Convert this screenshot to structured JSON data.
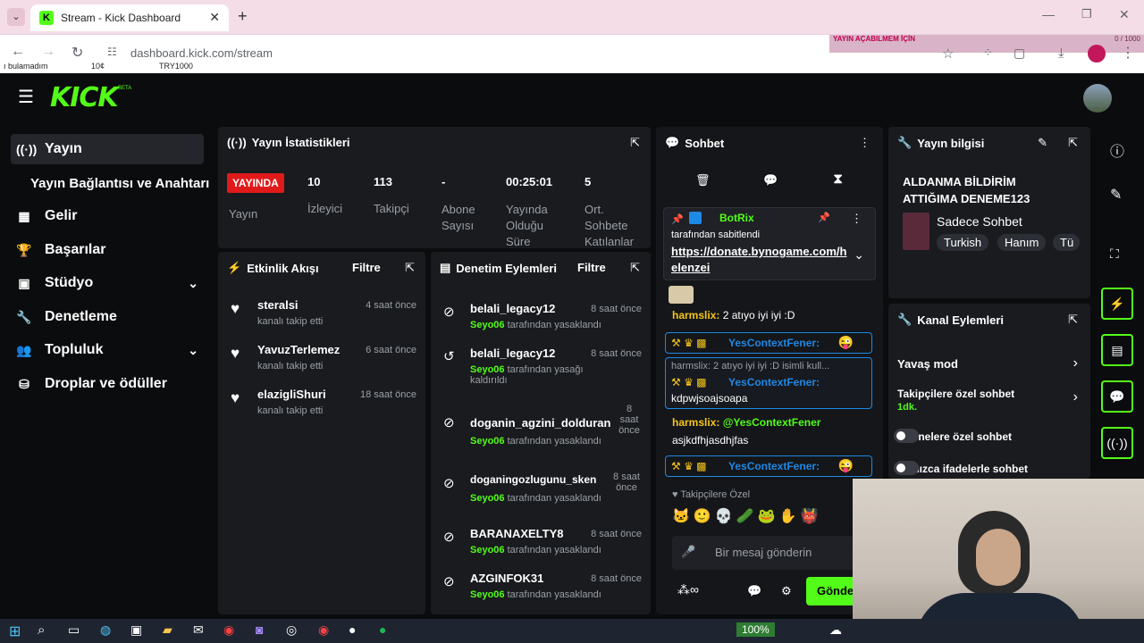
{
  "browser": {
    "tab_title": "Stream - Kick Dashboard",
    "url": "dashboard.kick.com/stream",
    "bookmarks": [
      "ı bulamadım",
      "10¢",
      "TRY1000"
    ],
    "overlay_title": "YAYIN AÇABILMEM İÇİN",
    "overlay_count": "0 / 1000"
  },
  "header": {
    "logo": "KICK",
    "beta": "BETA"
  },
  "sidebar": {
    "items": [
      {
        "label": "Yayın",
        "icon": "broadcast-icon"
      },
      {
        "label": "Yayın Bağlantısı ve Anahtarı",
        "icon": ""
      },
      {
        "label": "Gelir",
        "icon": "chart-icon"
      },
      {
        "label": "Başarılar",
        "icon": "trophy-icon"
      },
      {
        "label": "Stüdyo",
        "icon": "studio-icon"
      },
      {
        "label": "Denetleme",
        "icon": "wrench-icon"
      },
      {
        "label": "Topluluk",
        "icon": "community-icon"
      },
      {
        "label": "Droplar ve ödüller",
        "icon": "drops-icon"
      }
    ]
  },
  "stats": {
    "title": "Yayın İstatistikleri",
    "live_badge": "YAYINDA",
    "items": [
      {
        "value": "10",
        "label": "İzleyici"
      },
      {
        "value": "113",
        "label": "Takipçi"
      },
      {
        "value": "-",
        "label": "Abone Sayısı"
      },
      {
        "value": "00:25:01",
        "label": "Yayında Olduğu Süre"
      },
      {
        "value": "5",
        "label": "Ort. Sohbete Katılanlar"
      }
    ],
    "first_label": "Yayın"
  },
  "activity": {
    "title": "Etkinlik Akışı",
    "filter": "Filtre",
    "items": [
      {
        "name": "steralsi",
        "sub": "kanalı takip etti",
        "time": "4 saat önce"
      },
      {
        "name": "YavuzTerlemez",
        "sub": "kanalı takip etti",
        "time": "6 saat önce"
      },
      {
        "name": "elazigliShuri",
        "sub": "kanalı takip etti",
        "time": "18 saat önce"
      }
    ]
  },
  "moderation": {
    "title": "Denetim Eylemleri",
    "filter": "Filtre",
    "items": [
      {
        "name": "belali_legacy12",
        "mod": "Seyo06",
        "action": "tarafından yasaklandı",
        "time": "8 saat önce"
      },
      {
        "name": "belali_legacy12",
        "mod": "Seyo06",
        "action": "tarafından yasağı kaldırıldı",
        "time": "8 saat önce"
      },
      {
        "name": "doganin_agzini_dolduran",
        "mod": "Seyo06",
        "action": "tarafından yasaklandı",
        "time": "8 saat önce"
      },
      {
        "name": "doganingozlugunu_sken",
        "mod": "Seyo06",
        "action": "tarafından yasaklandı",
        "time": "8 saat önce"
      },
      {
        "name": "BARANAXELTY8",
        "mod": "Seyo06",
        "action": "tarafından yasaklandı",
        "time": "8 saat önce"
      },
      {
        "name": "AZGINFOK31",
        "mod": "Seyo06",
        "action": "tarafından yasaklandı",
        "time": "8 saat önce"
      }
    ]
  },
  "chat": {
    "title": "Sohbet",
    "pinned_user": "BotRix",
    "pinned_by": "tarafından sabitlendi",
    "pinned_link": "https://donate.bynogame.com/helenzei",
    "messages": [
      {
        "user": "harmslix:",
        "text": "2 atıyo iyi iyi :D"
      },
      {
        "user": "YesContextFener:",
        "text": ""
      },
      {
        "user": "harmslix: 2 atıyo iyi iyi :D isimli kull...",
        "text": ""
      },
      {
        "user": "YesContextFener:",
        "text": "kdpwjsoajsoapa"
      },
      {
        "user": "harmslix:",
        "text": "@YesContextFener"
      },
      {
        "user": "",
        "text": "asjkdfhjasdhjfas"
      },
      {
        "user": "YesContextFener:",
        "text": ""
      }
    ],
    "followers_only": "Takipçilere Özel",
    "placeholder": "Bir mesaj gönderin",
    "send": "Gönder"
  },
  "stream_info": {
    "title": "Yayın bilgisi",
    "stream_title": "ALDANMA BİLDİRİM ATTIĞIMA DENEME123",
    "category": "Sadece Sohbet",
    "tags": [
      "Turkish",
      "Hanım",
      "Tü"
    ]
  },
  "channel_actions": {
    "title": "Kanal Eylemleri",
    "items": [
      {
        "label": "Yavaş mod",
        "sub": ""
      },
      {
        "label": "Takipçilere özel sohbet",
        "sub": "1dk."
      },
      {
        "label": "Abonelere özel sohbet",
        "sub": ""
      },
      {
        "label": "Yalnızca ifadelerle sohbet",
        "sub": ""
      }
    ]
  },
  "taskbar": {
    "battery": "100%"
  },
  "colors": {
    "accent": "#53fc18",
    "live": "#e01a1a",
    "panel": "#191b1f"
  }
}
